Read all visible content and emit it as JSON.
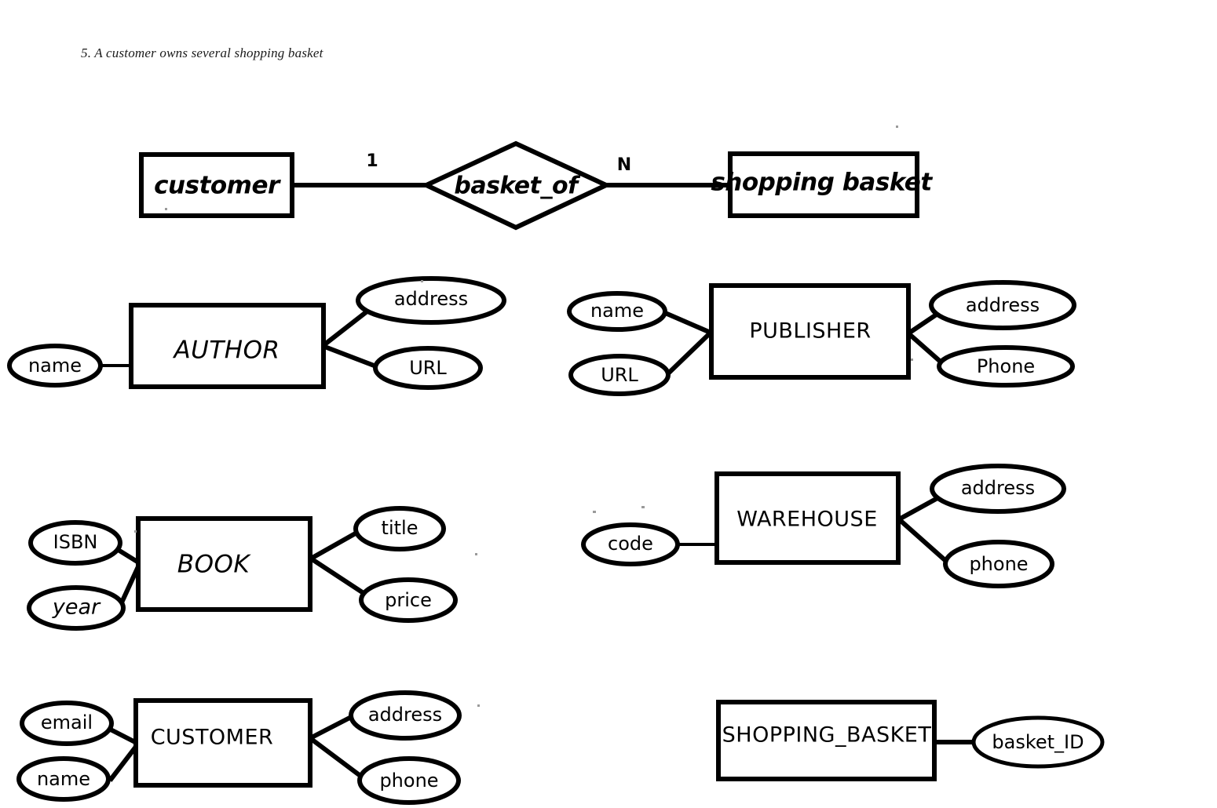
{
  "document": {
    "title": "5. A customer owns several shopping basket"
  },
  "diagrams": {
    "relationship": {
      "left_entity": "customer",
      "relationship": "basket_of",
      "right_entity": "shopping basket",
      "left_cardinality": "1",
      "right_cardinality": "N"
    },
    "entities": [
      {
        "name": "AUTHOR",
        "left_attributes": [
          "name"
        ],
        "right_attributes": [
          "address",
          "URL"
        ]
      },
      {
        "name": "PUBLISHER",
        "left_attributes": [
          "name",
          "URL"
        ],
        "right_attributes": [
          "address",
          "Phone"
        ]
      },
      {
        "name": "BOOK",
        "left_attributes": [
          "ISBN",
          "year"
        ],
        "right_attributes": [
          "title",
          "price"
        ]
      },
      {
        "name": "WAREHOUSE",
        "left_attributes": [
          "code"
        ],
        "right_attributes": [
          "address",
          "phone"
        ]
      },
      {
        "name": "CUSTOMER",
        "left_attributes": [
          "email",
          "name"
        ],
        "right_attributes": [
          "address",
          "phone"
        ]
      },
      {
        "name": "SHOPPING_BASKET",
        "left_attributes": [],
        "right_attributes": [
          "basket_ID"
        ]
      }
    ]
  },
  "colors": {
    "stroke": "#000000",
    "fill": "#ffffff",
    "text": "#000000"
  }
}
